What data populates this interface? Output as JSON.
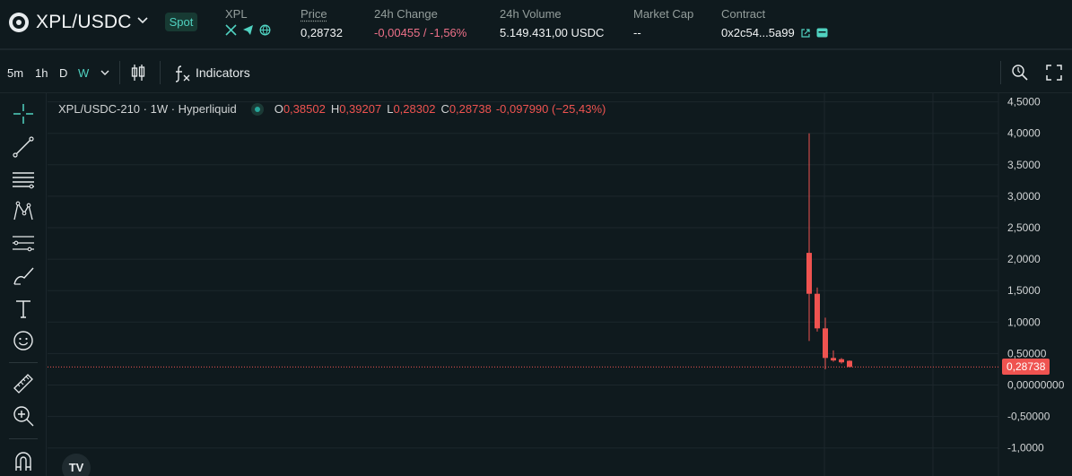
{
  "header": {
    "pair": "XPL/USDC",
    "badge": "Spot",
    "token_label": "XPL",
    "price_label": "Price",
    "price": "0,28732",
    "change_label": "24h Change",
    "change": "-0,00455 / -1,56%",
    "volume_label": "24h Volume",
    "volume": "5.149.431,00 USDC",
    "mcap_label": "Market Cap",
    "mcap": "--",
    "contract_label": "Contract",
    "contract": "0x2c54...5a99"
  },
  "toolbar": {
    "timeframes": [
      "5m",
      "1h",
      "D",
      "W"
    ],
    "active_timeframe": "W",
    "indicators_label": "Indicators"
  },
  "legend": {
    "symbol": "XPL/USDC-210 · 1W · Hyperliquid",
    "o_key": "O",
    "o": "0,38502",
    "h_key": "H",
    "h": "0,39207",
    "l_key": "L",
    "l": "0,28302",
    "c_key": "C",
    "c": "0,28738",
    "change": "-0,097990 (−25,43%)"
  },
  "colors": {
    "accent": "#50d2c1",
    "down": "#ef5350",
    "negative_text": "#ed7088",
    "background": "#0f1a1e"
  },
  "chart_data": {
    "type": "candlestick",
    "y_ticks": [
      "4,5000",
      "4,0000",
      "3,5000",
      "3,0000",
      "2,5000",
      "2,0000",
      "1,5000",
      "1,0000",
      "0,50000",
      "0,00000000",
      "-0,50000",
      "-1,0000"
    ],
    "y_tick_values": [
      4.5,
      4.0,
      3.5,
      3.0,
      2.5,
      2.0,
      1.5,
      1.0,
      0.5,
      0.0,
      -0.5,
      -1.0
    ],
    "ylim": [
      -1.0,
      4.5
    ],
    "last_price": 0.28738,
    "last_price_label": "0,28738",
    "grid": true,
    "candles": [
      {
        "open": 2.1,
        "high": 4.0,
        "low": 0.7,
        "close": 1.45
      },
      {
        "open": 1.45,
        "high": 1.55,
        "low": 0.85,
        "close": 0.9
      },
      {
        "open": 0.9,
        "high": 1.07,
        "low": 0.25,
        "close": 0.43
      },
      {
        "open": 0.43,
        "high": 0.55,
        "low": 0.37,
        "close": 0.39
      },
      {
        "open": 0.41,
        "high": 0.43,
        "low": 0.34,
        "close": 0.36
      },
      {
        "open": 0.38502,
        "high": 0.39207,
        "low": 0.28302,
        "close": 0.28738
      }
    ]
  }
}
